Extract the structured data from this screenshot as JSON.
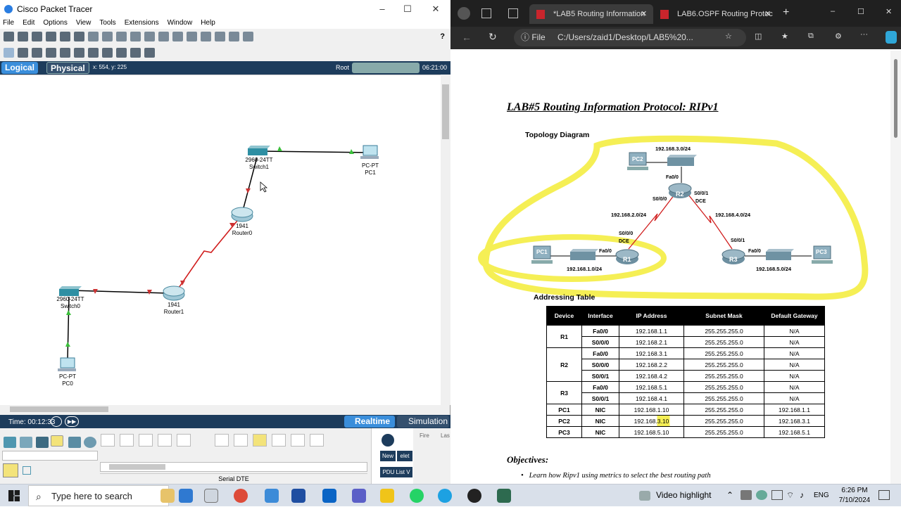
{
  "pt": {
    "title": "Cisco Packet Tracer",
    "menu": [
      "File",
      "Edit",
      "Options",
      "View",
      "Tools",
      "Extensions",
      "Window",
      "Help"
    ],
    "nav": {
      "logical": "Logical",
      "physical": "Physical",
      "coords": "x: 554, y: 225",
      "root": "Root",
      "clock": "06:21:00"
    },
    "devices": {
      "switch1_model": "2960-24TT",
      "switch1_name": "Switch1",
      "pc1_model": "PC-PT",
      "pc1_name": "PC1",
      "router0_model": "1941",
      "router0_name": "Router0",
      "router1_model": "1941",
      "router1_name": "Router1",
      "switch0_model": "2960-24TT",
      "switch0_name": "Switch0",
      "pc0_model": "PC-PT",
      "pc0_name": "PC0"
    },
    "time": "Time: 00:12:33",
    "realtime": "Realtime",
    "simulation": "Simulation",
    "cable_label": "Serial DTE",
    "pdu": {
      "new": "New",
      "delete": "elet",
      "list": "PDU List V",
      "fire": "Fire",
      "last": "Las"
    }
  },
  "edge": {
    "tabs": [
      {
        "label": "*LAB5 Routing Information"
      },
      {
        "label": "LAB6.OSPF Routing Protoc"
      }
    ],
    "file_label": "File",
    "url": "C:/Users/zaid1/Desktop/LAB5%20..."
  },
  "doc": {
    "title": "LAB#5  Routing  Information  Protocol: RIPv1",
    "topology_heading": "Topology Diagram",
    "topology": {
      "net_r2": "192.168.3.0/24",
      "r2": "R2",
      "r1": "R1",
      "r3": "R3",
      "pc1": "PC1",
      "pc2": "PC2",
      "pc3": "PC3",
      "r2_fa": "Fa0/0",
      "r2_s000": "S0/0/0",
      "r2_s001": "S0/0/1",
      "dce": "DCE",
      "net_12": "192.168.2.0/24",
      "net_24": "192.168.4.0/24",
      "r1_s000": "S0/0/0",
      "r1_dce": "DCE",
      "r1_fa": "Fa0/0",
      "r3_s001": "S0/0/1",
      "r3_fa": "Fa0/0",
      "net_r1": "192.168.1.0/24",
      "net_r3": "192.168.5.0/24"
    },
    "addressing_heading": "Addressing Table",
    "table_headers": [
      "Device",
      "Interface",
      "IP Address",
      "Subnet Mask",
      "Default Gateway"
    ],
    "rows": [
      [
        "R1",
        "Fa0/0",
        "192.168.1.1",
        "255.255.255.0",
        "N/A"
      ],
      [
        "",
        "S0/0/0",
        "192.168.2.1",
        "255.255.255.0",
        "N/A"
      ],
      [
        "R2",
        "Fa0/0",
        "192.168.3.1",
        "255.255.255.0",
        "N/A"
      ],
      [
        "",
        "S0/0/0",
        "192.168.2.2",
        "255.255.255.0",
        "N/A"
      ],
      [
        "",
        "S0/0/1",
        "192.168.4.2",
        "255.255.255.0",
        "N/A"
      ],
      [
        "R3",
        "Fa0/0",
        "192.168.5.1",
        "255.255.255.0",
        "N/A"
      ],
      [
        "",
        "S0/0/1",
        "192.168.4.1",
        "255.255.255.0",
        "N/A"
      ],
      [
        "PC1",
        "NIC",
        "192.168.1.10",
        "255.255.255.0",
        "192.168.1.1"
      ],
      [
        "PC2",
        "NIC",
        "192.168.3.10",
        "255.255.255.0",
        "192.168.3.1"
      ],
      [
        "PC3",
        "NIC",
        "192.168.5.10",
        "255.255.255.0",
        "192.168.5.1"
      ]
    ],
    "objectives_heading": "Objectives:",
    "objective_1": "Learn how Ripv1 using metrics to select the best routing path"
  },
  "taskbar": {
    "search_placeholder": "Type here to search",
    "video_highlight": "Video highlight",
    "lang": "ENG",
    "time": "6:26 PM",
    "date": "7/10/2024"
  },
  "colors": {
    "pt_nav": "#1d3c5c",
    "highlight": "#f5ef55",
    "serial": "#d01c1c"
  }
}
